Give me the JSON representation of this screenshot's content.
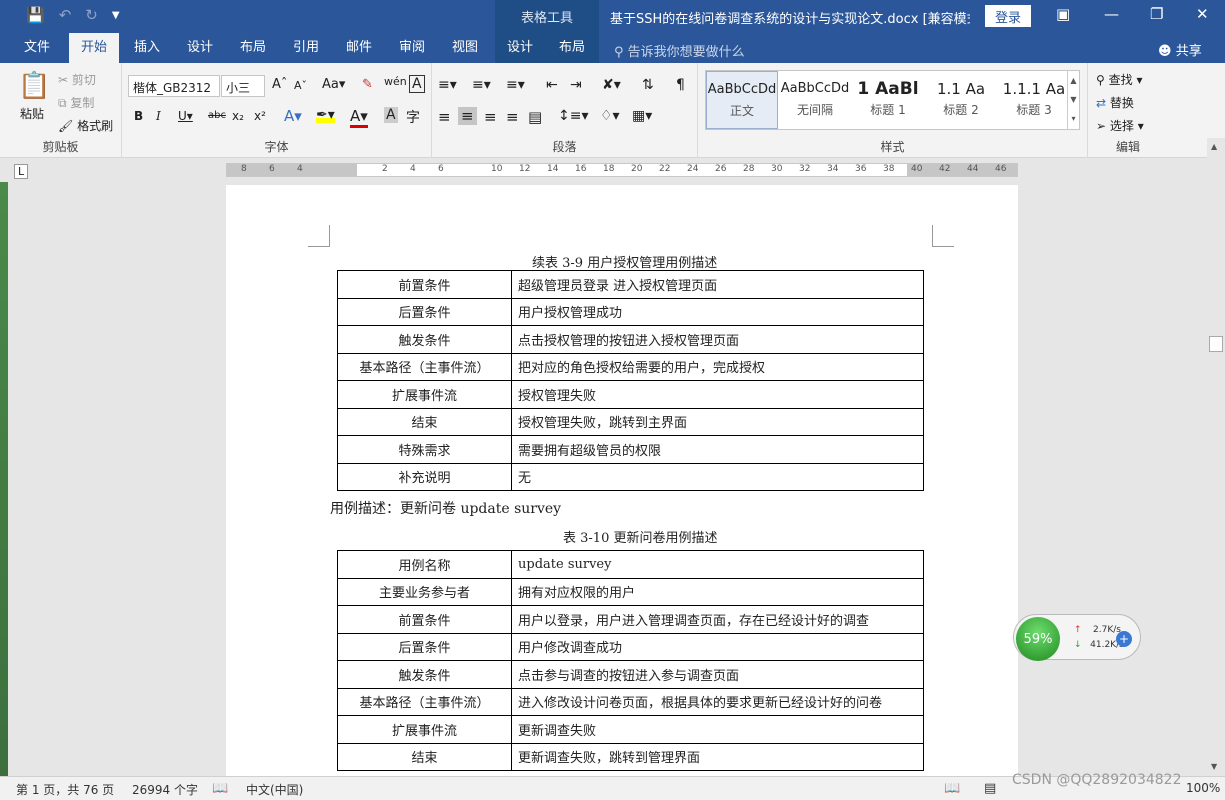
{
  "titlebar": {
    "context_tab": "表格工具",
    "title": "基于SSH的在线问卷调查系统的设计与实现论文.docx [兼容模式]...",
    "login": "登录",
    "icons": [
      "save-icon",
      "undo-icon",
      "redo-icon",
      "customize-qat-icon"
    ]
  },
  "tabs": [
    {
      "label": "文件"
    },
    {
      "label": "开始"
    },
    {
      "label": "插入"
    },
    {
      "label": "设计"
    },
    {
      "label": "布局"
    },
    {
      "label": "引用"
    },
    {
      "label": "邮件"
    },
    {
      "label": "审阅"
    },
    {
      "label": "视图"
    },
    {
      "label": "设计"
    },
    {
      "label": "布局"
    }
  ],
  "tellme": "告诉我你想要做什么",
  "share": "共享",
  "ribbon": {
    "clipboard": {
      "paste": "粘贴",
      "cut": "剪切",
      "copy": "复制",
      "format_painter": "格式刷",
      "label": "剪贴板"
    },
    "font": {
      "name": "楷体_GB2312",
      "size": "小三",
      "label": "字体"
    },
    "paragraph": {
      "label": "段落"
    },
    "styles": {
      "label": "样式",
      "items": [
        {
          "preview": "AaBbCcDd",
          "name": "正文"
        },
        {
          "preview": "AaBbCcDd",
          "name": "无间隔"
        },
        {
          "preview": "1 AaBl",
          "name": "标题 1"
        },
        {
          "preview": "1.1 Aa",
          "name": "标题 2"
        },
        {
          "preview": "1.1.1 Aa",
          "name": "标题 3"
        }
      ]
    },
    "editing": {
      "find": "查找",
      "replace": "替换",
      "select": "选择",
      "label": "编辑"
    }
  },
  "ruler": {
    "left_numbers": [
      "8",
      "6",
      "4"
    ],
    "right_numbers": [
      "2",
      "4",
      "6",
      "10",
      "12",
      "14",
      "16",
      "18",
      "20",
      "22",
      "24",
      "26",
      "28",
      "30",
      "32",
      "34",
      "36",
      "38",
      "40",
      "42",
      "44",
      "46"
    ]
  },
  "document": {
    "caption1": "续表 3-9 用户授权管理用例描述",
    "table1": [
      {
        "k": "前置条件",
        "v": "超级管理员登录 进入授权管理页面"
      },
      {
        "k": "后置条件",
        "v": "用户授权管理成功"
      },
      {
        "k": "触发条件",
        "v": "点击授权管理的按钮进入授权管理页面"
      },
      {
        "k": "基本路径（主事件流）",
        "v": "把对应的角色授权给需要的用户，完成授权"
      },
      {
        "k": "扩展事件流",
        "v": "授权管理失败"
      },
      {
        "k": "结束",
        "v": "授权管理失败，跳转到主界面"
      },
      {
        "k": "特殊需求",
        "v": "需要拥有超级管员的权限"
      },
      {
        "k": "补充说明",
        "v": "无"
      }
    ],
    "heading": "用例描述：更新问卷 update survey",
    "caption2": "表 3-10 更新问卷用例描述",
    "table2": [
      {
        "k": "用例名称",
        "v": "update survey"
      },
      {
        "k": "主要业务参与者",
        "v": "拥有对应权限的用户"
      },
      {
        "k": "前置条件",
        "v": "用户以登录，用户进入管理调查页面，存在已经设计好的调查"
      },
      {
        "k": "后置条件",
        "v": "用户修改调查成功"
      },
      {
        "k": "触发条件",
        "v": "点击参与调查的按钮进入参与调查页面"
      },
      {
        "k": "基本路径（主事件流）",
        "v": "进入修改设计问卷页面，根据具体的要求更新已经设计好的问卷"
      },
      {
        "k": "扩展事件流",
        "v": "更新调查失败"
      },
      {
        "k": "结束",
        "v": "更新调查失败，跳转到管理界面"
      }
    ]
  },
  "status": {
    "page": "第 1 页，共 76 页",
    "words": "26994 个字",
    "lang": "中文(中国)",
    "zoom": "100%"
  },
  "widget": {
    "percent": "59%",
    "up": "2.7K/s",
    "down": "41.2K/s"
  },
  "watermark": "CSDN @QQ2892034822"
}
